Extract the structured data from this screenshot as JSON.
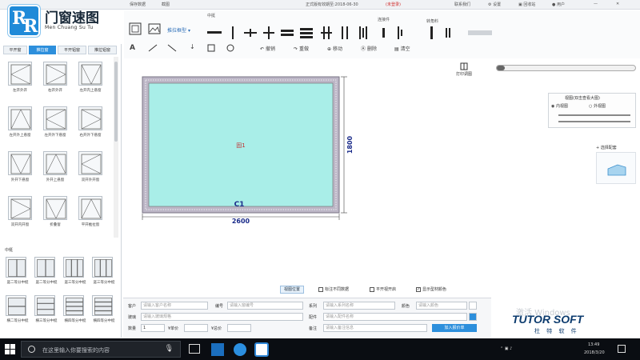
{
  "titlebar": {
    "save_label": "保存数据",
    "nav_label": "截图",
    "document_title": "正式版有效期至:2018-06-30",
    "status_badge": "(未登录)",
    "contact_label": "联系我们",
    "settings_label": "设置",
    "recycle_label": "回收站",
    "user_label": "用户"
  },
  "logo": {
    "mark_letters": [
      "R",
      "R"
    ],
    "name": "门窗速图",
    "pinyin": "Men Chuang Su Tu"
  },
  "toolbar": {
    "profile_select": "推拉框型",
    "mullion_group_label": "中挺",
    "linkage_label": "连接件",
    "corner_label": "转角料",
    "tools": [
      {
        "icon": "↶",
        "label": "撤销"
      },
      {
        "icon": "↷",
        "label": "重做"
      },
      {
        "icon": "⊕",
        "label": "移动"
      },
      {
        "icon": "Ⓐ",
        "label": "删除"
      },
      {
        "icon": "▤",
        "label": "清空"
      }
    ],
    "draw_text_icon": "A"
  },
  "left_panel": {
    "tabs": [
      "平开窗",
      "推拉窗",
      "平开铝窗",
      "推拉铝窗"
    ],
    "active_tab": 1,
    "templates": [
      "左开外开",
      "右开外开",
      "左开内上悬窗",
      "左开外上悬窗",
      "左开外下悬窗",
      "右开外下悬窗",
      "外开下悬窗",
      "外开上悬窗",
      "双开外开窗",
      "双开内开窗",
      "折叠窗",
      "平开推拉窗"
    ],
    "section_title": "中梃",
    "mullion_templates": [
      "竖二等分中梃",
      "竖二等分中梃",
      "竖三等分中梃",
      "竖三等分中梃",
      "横二等分中梃",
      "横三等分中梃",
      "横四等分中梃",
      "横四等分中梃"
    ]
  },
  "canvas": {
    "window_id": "C1",
    "sash_label": "固1",
    "width_dim": "2600",
    "height_dim": "1800",
    "glass_color": "#a9eee8"
  },
  "right_panel": {
    "print_label": "打印调图",
    "view_header": "视图(双击查看大图)",
    "inner_view": "内视图",
    "outer_view": "外视图",
    "hardware_btn": "选择配套"
  },
  "view_options": {
    "button": "视图位置",
    "chk_1": "标注不同数据",
    "chk_2": "平开视开启",
    "chk_3": "显示型材颜色"
  },
  "form": {
    "customer_label": "客户",
    "customer_ph": "请输入客户名称",
    "number_label": "编号",
    "number_ph": "请输入窗编号",
    "series_label": "系列",
    "series_ph": "请输入系列名称",
    "color_label": "颜色",
    "color_ph": "请输入颜色",
    "glass_label": "玻璃",
    "glass_ph": "请输入玻璃规格",
    "config_label": "配件",
    "config_ph": "请输入配件名称",
    "qty_label": "数量",
    "qty_value": "1",
    "price_label": "¥单价",
    "sum_label": "¥总价",
    "remark_label": "备注",
    "remark_ph": "请输入备注信息",
    "add_btn": "加入报价单"
  },
  "watermark": "激活 Windows",
  "brand": {
    "name": "TUTOR SOFT",
    "sub": "杜 特 软 件"
  },
  "taskbar": {
    "search_placeholder": "在这里输入你要搜索的内容",
    "time": "13:49",
    "date": "2018/3/20"
  },
  "colors": {
    "accent": "#2d8fdc",
    "glass": "#a9eee8",
    "frame": "#bcb6c6"
  }
}
